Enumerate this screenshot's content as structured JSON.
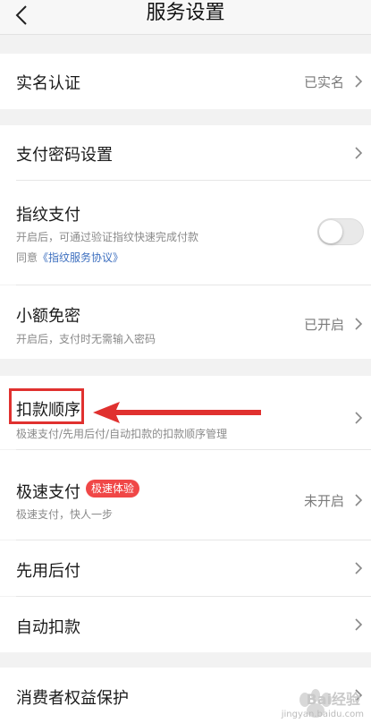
{
  "header": {
    "title": "服务设置",
    "back_icon": "chevron-left-icon"
  },
  "identity": {
    "label": "实名认证",
    "status": "已实名"
  },
  "payment": {
    "password_label": "支付密码设置",
    "fingerprint_label": "指纹支付",
    "fingerprint_desc": "开启后，可通过验证指纹快速完成付款",
    "fingerprint_agree_prefix": "同意",
    "fingerprint_agree_link": "《指纹服务协议》",
    "fingerprint_enabled": false,
    "small_amount_label": "小额免密",
    "small_amount_desc": "开启后，支付时无需输入密码",
    "small_amount_status": "已开启"
  },
  "deduction": {
    "order_label": "扣款顺序",
    "order_desc": "极速支付/先用后付/自动扣款的扣款顺序管理",
    "fast_pay_label": "极速支付",
    "fast_pay_badge": "极速体验",
    "fast_pay_desc": "极速支付，快人一步",
    "fast_pay_status": "未开启",
    "pay_later_label": "先用后付",
    "auto_deduct_label": "自动扣款"
  },
  "consumer": {
    "label": "消费者权益保护"
  },
  "watermark": {
    "text": "Bai经验",
    "sub": "jingyan.baidu.com"
  },
  "colors": {
    "accent_red": "#f04747",
    "link_blue": "#3d6fbf",
    "annotation_red": "#e0312f"
  }
}
